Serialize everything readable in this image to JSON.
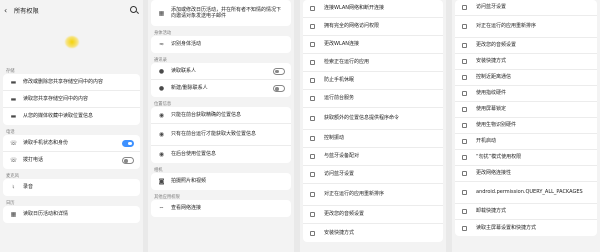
{
  "panel1": {
    "back_glyph": "‹",
    "title": "所有权限",
    "sections": [
      {
        "label": "存储",
        "items": [
          {
            "icon": "folder-icon",
            "glyph": "▬",
            "label": "修改或删除您共享存储空间中的内容"
          },
          {
            "icon": "folder-icon",
            "glyph": "▬",
            "label": "读取您共享存储空间中的内容"
          },
          {
            "icon": "folder-icon",
            "glyph": "▬",
            "label": "从您的媒体收藏中读取位置信息"
          }
        ]
      },
      {
        "label": "电话",
        "items": [
          {
            "icon": "phone-icon",
            "glyph": "☏",
            "label": "读取手机状态和身份",
            "toggle": true
          },
          {
            "icon": "phone-icon",
            "glyph": "☏",
            "label": "拨打电话",
            "toggle": false
          }
        ]
      },
      {
        "label": "麦克风",
        "items": [
          {
            "icon": "microphone-icon",
            "glyph": "🎙",
            "label": "录音"
          }
        ]
      },
      {
        "label": "日历",
        "items": [
          {
            "icon": "calendar-icon",
            "glyph": "▦",
            "label": "读取日历活动和详情"
          }
        ]
      }
    ]
  },
  "panel2": {
    "top_item": {
      "icon": "calendar-icon",
      "glyph": "▦",
      "label": "添加或修改日历活动，并在所有者不知情的情况下向邀请对象发送电子邮件"
    },
    "sections": [
      {
        "label": "身体活动",
        "items": [
          {
            "icon": "activity-icon",
            "glyph": "≈",
            "label": "识别身体活动"
          }
        ]
      },
      {
        "label": "通讯录",
        "items": [
          {
            "icon": "contact-icon",
            "glyph": "●",
            "label": "读取联系人",
            "toggle": false
          },
          {
            "icon": "contact-icon",
            "glyph": "●",
            "label": "新建/删除联系人",
            "toggle": false
          }
        ]
      },
      {
        "label": "位置信息",
        "items": [
          {
            "icon": "location-icon",
            "glyph": "◉",
            "label": "只能在前台获取精确的位置信息"
          },
          {
            "icon": "location-icon",
            "glyph": "◉",
            "label": "只有在前台运行才能获取大致位置信息"
          },
          {
            "icon": "location-icon",
            "glyph": "◉",
            "label": "在后台使用位置信息"
          }
        ]
      },
      {
        "label": "相机",
        "items": [
          {
            "icon": "camera-icon",
            "glyph": "◙",
            "label": "拍摄照片和视频"
          }
        ]
      },
      {
        "label": "其他应用权限",
        "items": [
          {
            "icon": "wifi-icon",
            "glyph": "⌔",
            "label": "查看网络连接"
          }
        ]
      }
    ]
  },
  "panel3": {
    "items": [
      "连接WLAN网络和断开连接",
      "拥有完全的网络访问权限",
      "更改WLAN连接",
      "检索正在运行的应用",
      "防止手机休眠",
      "运行前台服务",
      "获取额外的位置信息提供程序命令",
      "控制振动",
      "与蓝牙设备配对",
      "访问蓝牙设置",
      "对正在运行的应用重新排序",
      "更改您的音频设置",
      "安装快捷方式"
    ]
  },
  "panel4": {
    "items": [
      "访问蓝牙设置",
      "对正在运行的应用重新排序",
      "更改您的音频设置",
      "安装快捷方式",
      "控制近距离通信",
      "使用指纹硬件",
      "使用屏幕锁定",
      "使用生物识别硬件",
      "开机启动",
      "“勿扰”模式使用权限",
      "更改网络连接性",
      "android.permission.QUERY_ALL_PACKAGES",
      "卸载快捷方式",
      "读取主屏幕设置和快捷方式"
    ]
  }
}
